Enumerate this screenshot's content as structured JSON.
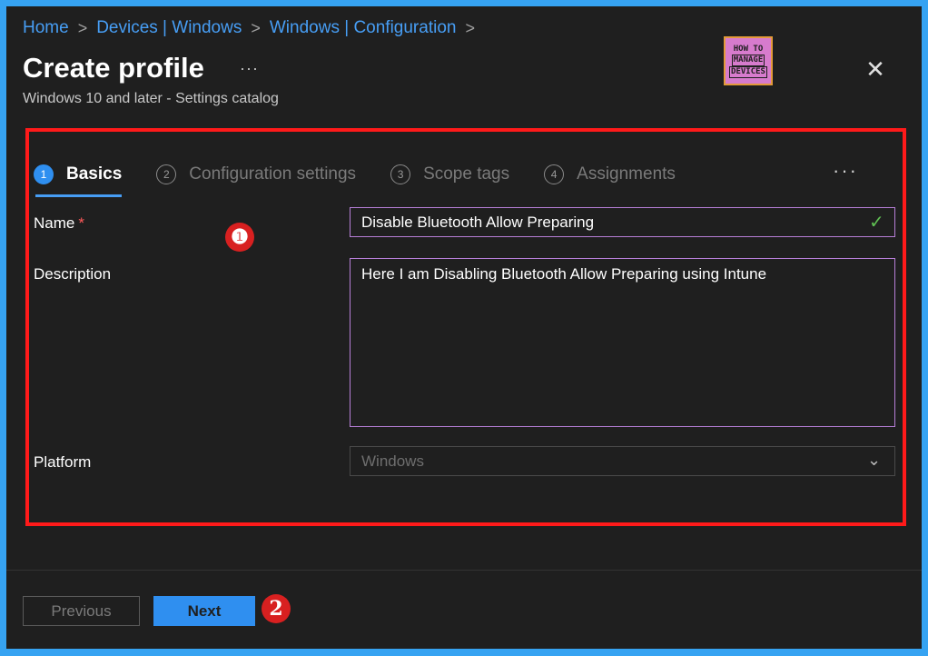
{
  "breadcrumb": {
    "items": [
      "Home",
      "Devices | Windows",
      "Windows | Configuration"
    ],
    "separator": ">"
  },
  "header": {
    "title": "Create profile",
    "more_label": "···",
    "subtitle": "Windows 10 and later - Settings catalog",
    "close_label": "✕"
  },
  "logo": {
    "line1": "HOW TO",
    "line2": "MANAGE",
    "line3": "DEVICES"
  },
  "tabs": [
    {
      "number": "1",
      "label": "Basics",
      "active": true
    },
    {
      "number": "2",
      "label": "Configuration settings",
      "active": false
    },
    {
      "number": "3",
      "label": "Scope tags",
      "active": false
    },
    {
      "number": "4",
      "label": "Assignments",
      "active": false
    }
  ],
  "tabs_more": "···",
  "form": {
    "name_label": "Name",
    "required_mark": "*",
    "name_value": "Disable Bluetooth Allow Preparing",
    "description_label": "Description",
    "description_value": "Here I am Disabling Bluetooth Allow Preparing using Intune",
    "platform_label": "Platform",
    "platform_value": "Windows"
  },
  "markers": {
    "one": "❶",
    "two": "2"
  },
  "footer": {
    "previous_label": "Previous",
    "next_label": "Next"
  },
  "colors": {
    "accent": "#2f8ff0",
    "highlight": "#ff1a1a",
    "input_border": "#b77fd8",
    "success": "#5fbf52"
  }
}
